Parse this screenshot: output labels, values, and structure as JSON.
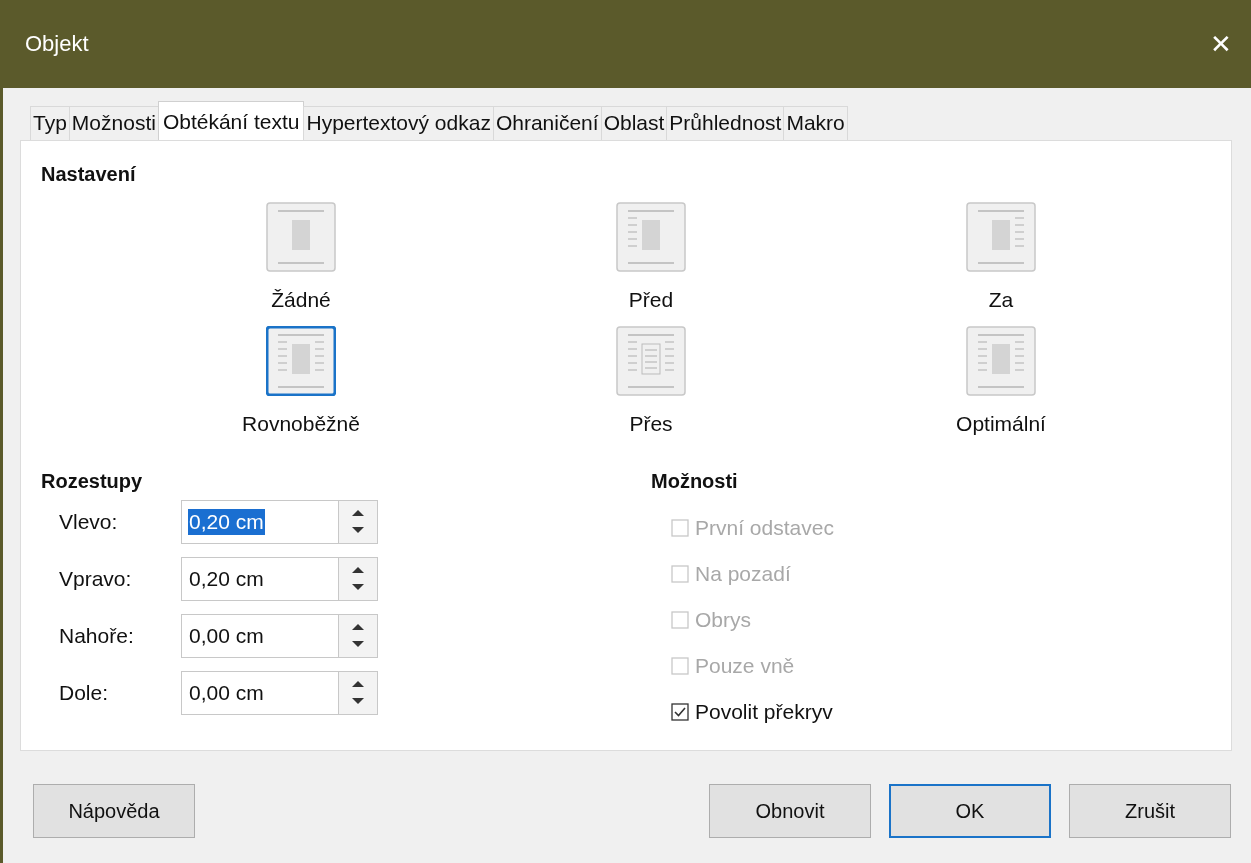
{
  "window": {
    "title": "Objekt",
    "close": "✕"
  },
  "tabs": [
    {
      "label": "Typ",
      "selected": false
    },
    {
      "label": "Možnosti",
      "selected": false
    },
    {
      "label": "Obtékání textu",
      "selected": true
    },
    {
      "label": "Hypertextový odkaz",
      "selected": false
    },
    {
      "label": "Ohraničení",
      "selected": false
    },
    {
      "label": "Oblast",
      "selected": false
    },
    {
      "label": "Průhlednost",
      "selected": false
    },
    {
      "label": "Makro",
      "selected": false
    }
  ],
  "settings": {
    "heading": "Nastavení",
    "options": [
      {
        "label": "Žádné",
        "kind": "none",
        "selected": false
      },
      {
        "label": "Před",
        "kind": "before",
        "selected": false
      },
      {
        "label": "Za",
        "kind": "after",
        "selected": false
      },
      {
        "label": "Rovnoběžně",
        "kind": "parallel",
        "selected": true
      },
      {
        "label": "Přes",
        "kind": "through",
        "selected": false
      },
      {
        "label": "Optimální",
        "kind": "optimal",
        "selected": false
      }
    ]
  },
  "spacing": {
    "heading": "Rozestupy",
    "fields": [
      {
        "label": "Vlevo:",
        "value": "0,20 cm",
        "selected": true
      },
      {
        "label": "Vpravo:",
        "value": "0,20 cm",
        "selected": false
      },
      {
        "label": "Nahoře:",
        "value": "0,00 cm",
        "selected": false
      },
      {
        "label": "Dole:",
        "value": "0,00 cm",
        "selected": false
      }
    ]
  },
  "options": {
    "heading": "Možnosti",
    "items": [
      {
        "label": "První odstavec",
        "checked": false,
        "disabled": true
      },
      {
        "label": "Na pozadí",
        "checked": false,
        "disabled": true
      },
      {
        "label": "Obrys",
        "checked": false,
        "disabled": true
      },
      {
        "label": "Pouze vně",
        "checked": false,
        "disabled": true
      },
      {
        "label": "Povolit překryv",
        "checked": true,
        "disabled": false
      }
    ]
  },
  "buttons": [
    {
      "label": "Nápověda",
      "kind": "help",
      "default": false
    },
    {
      "label": "Obnovit",
      "kind": "reset",
      "default": false
    },
    {
      "label": "OK",
      "kind": "ok",
      "default": true
    },
    {
      "label": "Zrušit",
      "kind": "cancel",
      "default": false
    }
  ]
}
